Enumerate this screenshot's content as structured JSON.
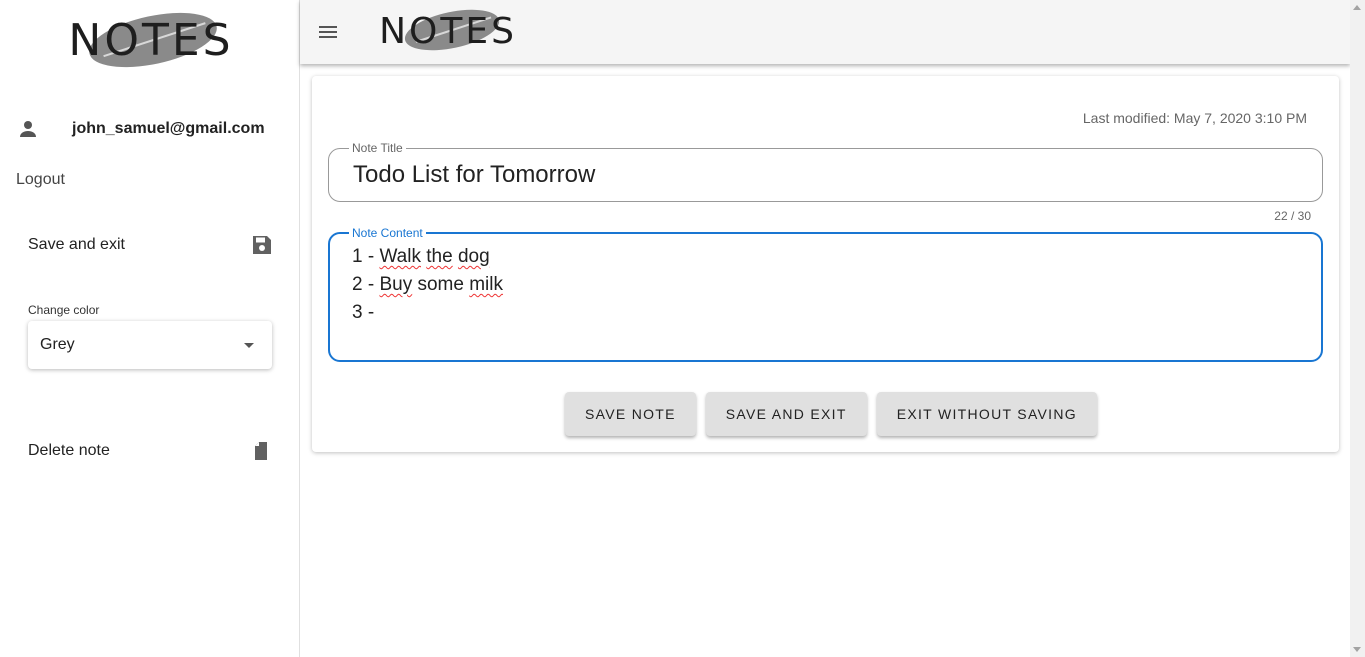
{
  "app": {
    "logo_text": "NOTES"
  },
  "sidebar": {
    "user_email": "john_samuel@gmail.com",
    "logout_label": "Logout",
    "save_exit_label": "Save and exit",
    "color_label": "Change color",
    "color_value": "Grey",
    "delete_label": "Delete note"
  },
  "note": {
    "last_modified": "Last modified: May 7, 2020 3:10 PM",
    "title_legend": "Note Title",
    "title_value": "Todo List for Tomorrow",
    "char_count": "22 / 30",
    "content_legend": "Note Content",
    "content_lines": [
      {
        "prefix": "1 - ",
        "words": [
          {
            "t": "Walk",
            "spell": true
          },
          {
            "t": " ",
            "spell": false
          },
          {
            "t": "the",
            "spell": true
          },
          {
            "t": " ",
            "spell": false
          },
          {
            "t": "dog",
            "spell": true
          }
        ]
      },
      {
        "prefix": "2 - ",
        "words": [
          {
            "t": "Buy",
            "spell": true
          },
          {
            "t": " some ",
            "spell": false
          },
          {
            "t": "milk",
            "spell": true
          }
        ]
      },
      {
        "prefix": "3 - ",
        "words": []
      }
    ]
  },
  "buttons": {
    "save_note": "SAVE NOTE",
    "save_and_exit": "SAVE AND EXIT",
    "exit_without_saving": "EXIT WITHOUT SAVING"
  },
  "icons": {
    "person": "person-icon",
    "save": "floppy-disk-icon",
    "delete": "delete-file-icon",
    "menu": "hamburger-menu-icon",
    "dropdown": "chevron-down-icon"
  },
  "colors": {
    "accent": "#1976d2",
    "header_bg": "#f5f5f5",
    "button_bg": "#e0e0e0"
  }
}
